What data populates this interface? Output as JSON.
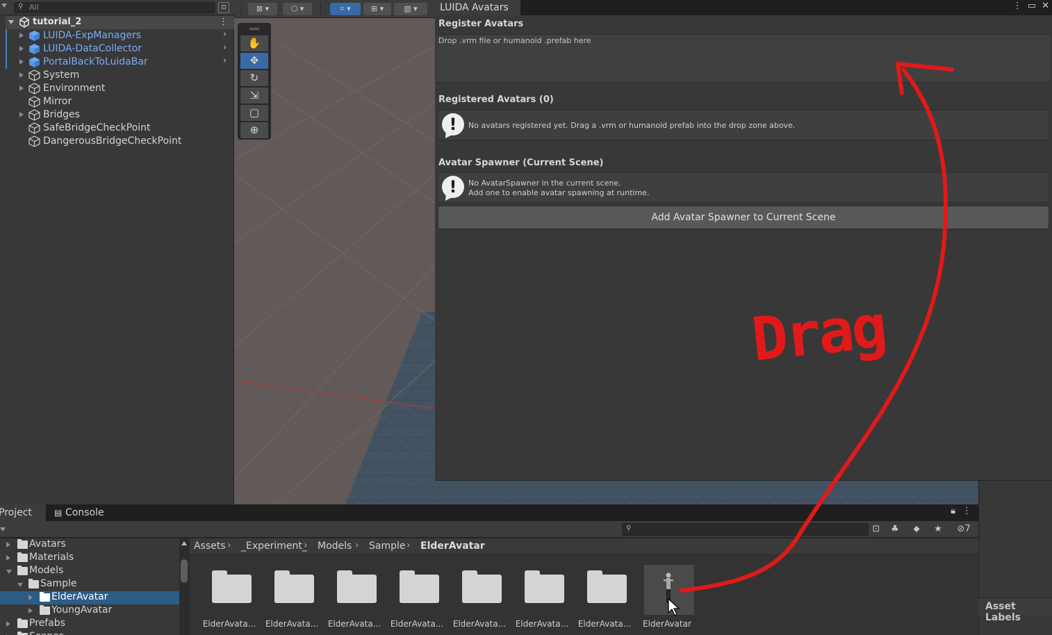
{
  "hierarchy": {
    "search_placeholder": "All",
    "scene_name": "tutorial_2",
    "items": [
      {
        "label": "LUIDA-ExpManagers",
        "type": "prefab"
      },
      {
        "label": "LUIDA-DataCollector",
        "type": "prefab"
      },
      {
        "label": "PortalBackToLuidaBar",
        "type": "prefab"
      },
      {
        "label": "System",
        "type": "object"
      },
      {
        "label": "Environment",
        "type": "object"
      },
      {
        "label": "Mirror",
        "type": "object"
      },
      {
        "label": "Bridges",
        "type": "object"
      },
      {
        "label": "SafeBridgeCheckPoint",
        "type": "object"
      },
      {
        "label": "DangerousBridgeCheckPoint",
        "type": "object"
      }
    ]
  },
  "scene_tools": [
    "hand-icon",
    "move-icon",
    "rotate-icon",
    "scale-icon",
    "rect-icon",
    "transform-icon"
  ],
  "luida": {
    "tab_title": "LUIDA Avatars",
    "register_heading": "Register Avatars",
    "drop_hint": "Drop .vrm file or humanoid .prefab here",
    "registered_heading": "Registered Avatars (0)",
    "registered_msg": "No avatars registered yet. Drag a .vrm or humanoid prefab into the drop zone above.",
    "spawner_heading": "Avatar Spawner (Current Scene)",
    "spawner_msg_1": "No AvatarSpawner in the current scene.",
    "spawner_msg_2": "Add one to enable avatar spawning at runtime.",
    "add_button": "Add Avatar Spawner to Current Scene"
  },
  "project": {
    "tab_project": "Project",
    "tab_console": "Console",
    "filter_count": "7",
    "tree": [
      {
        "label": "Avatars",
        "depth": 0,
        "open": false,
        "selected": false
      },
      {
        "label": "Materials",
        "depth": 0,
        "open": false,
        "selected": false
      },
      {
        "label": "Models",
        "depth": 0,
        "open": true,
        "selected": false
      },
      {
        "label": "Sample",
        "depth": 1,
        "open": true,
        "selected": false
      },
      {
        "label": "ElderAvatar",
        "depth": 2,
        "open": false,
        "selected": true
      },
      {
        "label": "YoungAvatar",
        "depth": 2,
        "open": false,
        "selected": false
      },
      {
        "label": "Prefabs",
        "depth": 0,
        "open": false,
        "selected": false
      },
      {
        "label": "Scenes",
        "depth": 0,
        "open": false,
        "selected": false
      }
    ],
    "breadcrumb": [
      "Assets",
      "_Experiment_",
      "Models",
      "Sample",
      "ElderAvatar"
    ],
    "assets": [
      {
        "name": "ElderAvata...",
        "kind": "folder"
      },
      {
        "name": "ElderAvata...",
        "kind": "folder"
      },
      {
        "name": "ElderAvata...",
        "kind": "folder"
      },
      {
        "name": "ElderAvata...",
        "kind": "folder"
      },
      {
        "name": "ElderAvata...",
        "kind": "folder"
      },
      {
        "name": "ElderAvata...",
        "kind": "folder"
      },
      {
        "name": "ElderAvata...",
        "kind": "folder"
      },
      {
        "name": "ElderAvatar",
        "kind": "model"
      }
    ]
  },
  "inspector": {
    "asset_labels": "Asset Labels"
  },
  "annotation": {
    "text": "Drag",
    "color": "#e01a1a"
  }
}
